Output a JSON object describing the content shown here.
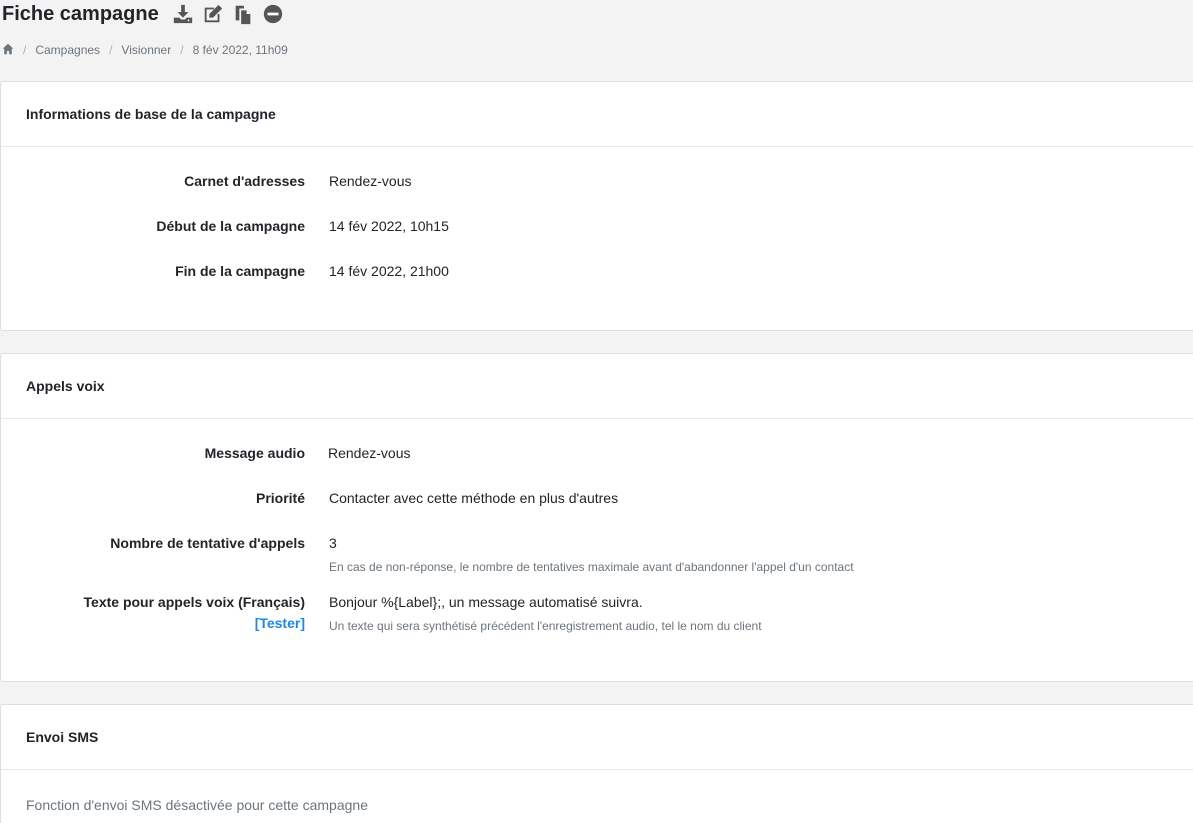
{
  "header": {
    "title": "Fiche campagne",
    "actions": [
      "download-icon",
      "edit-icon",
      "copy-icon",
      "minus-circle-icon"
    ]
  },
  "breadcrumb": {
    "home_icon": "home-icon",
    "items": [
      "Campagnes",
      "Visionner",
      "8 fév 2022, 11h09"
    ]
  },
  "base_info": {
    "title": "Informations de base de la campagne",
    "address_book_label": "Carnet d'adresses",
    "address_book_value": "Rendez-vous",
    "start_label": "Début de la campagne",
    "start_value": "14 fév 2022, 10h15",
    "end_label": "Fin de la campagne",
    "end_value": "14 fév 2022, 21h00"
  },
  "voice_calls": {
    "title": "Appels voix",
    "audio_label": "Message audio",
    "audio_value": "Rendez-vous",
    "priority_label": "Priorité",
    "priority_value": "Contacter avec cette méthode en plus d'autres",
    "attempts_label": "Nombre de tentative d'appels",
    "attempts_value": "3",
    "attempts_help": "En cas de non-réponse, le nombre de tentatives maximale avant d'abandonner l'appel d'un contact",
    "text_label": "Texte pour appels voix (Français)",
    "test_link": "[Tester]",
    "text_value": "Bonjour %{Label};, un message automatisé suivra.",
    "text_help": "Un texte qui sera synthétisé précédent l'enregistrement audio, tel le nom du client"
  },
  "sms": {
    "title": "Envoi SMS",
    "disabled_text": "Fonction d'envoi SMS désactivée pour cette campagne"
  }
}
